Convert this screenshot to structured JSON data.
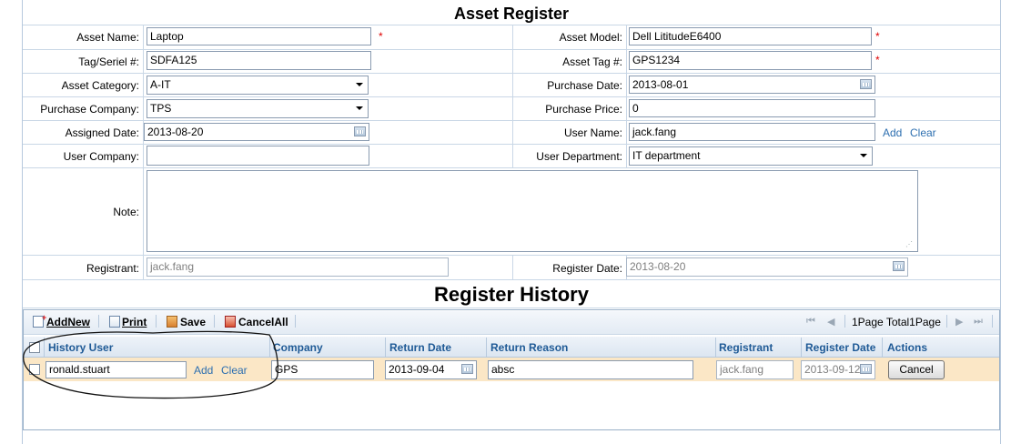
{
  "form": {
    "title": "Asset Register",
    "asset_name": {
      "label": "Asset Name:",
      "value": "Laptop"
    },
    "asset_model": {
      "label": "Asset Model:",
      "value": "Dell LititudeE6400"
    },
    "tag_serial": {
      "label": "Tag/Seriel #:",
      "value": "SDFA125"
    },
    "asset_tag": {
      "label": "Asset Tag #:",
      "value": "GPS1234"
    },
    "asset_category": {
      "label": "Asset Category:",
      "value": "A-IT"
    },
    "purchase_date": {
      "label": "Purchase Date:",
      "value": "2013-08-01"
    },
    "purchase_company": {
      "label": "Purchase Company:",
      "value": "TPS"
    },
    "purchase_price": {
      "label": "Purchase Price:",
      "value": "0"
    },
    "assigned_date": {
      "label": "Assigned Date:",
      "value": "2013-08-20"
    },
    "user_name": {
      "label": "User Name:",
      "value": "jack.fang",
      "add": "Add",
      "clear": "Clear"
    },
    "user_company": {
      "label": "User Company:",
      "value": ""
    },
    "user_department": {
      "label": "User Department:",
      "value": "IT department"
    },
    "note": {
      "label": "Note:",
      "value": ""
    },
    "registrant": {
      "label": "Registrant:",
      "value": "jack.fang"
    },
    "register_date": {
      "label": "Register Date:",
      "value": "2013-08-20"
    },
    "required_mark": "*"
  },
  "history": {
    "title": "Register History",
    "toolbar": {
      "add_new": "AddNew",
      "print": "Print",
      "save": "Save",
      "cancel_all": "CancelAll"
    },
    "pager": {
      "text": "1Page Total1Page"
    },
    "columns": [
      "History User",
      "Company",
      "Return Date",
      "Return Reason",
      "Registrant",
      "Register Date",
      "Actions"
    ],
    "rows": [
      {
        "history_user": "ronald.stuart",
        "add": "Add",
        "clear": "Clear",
        "company": "GPS",
        "return_date": "2013-09-04",
        "return_reason": "absc",
        "registrant": "jack.fang",
        "register_date": "2013-09-12",
        "action": "Cancel"
      }
    ]
  }
}
